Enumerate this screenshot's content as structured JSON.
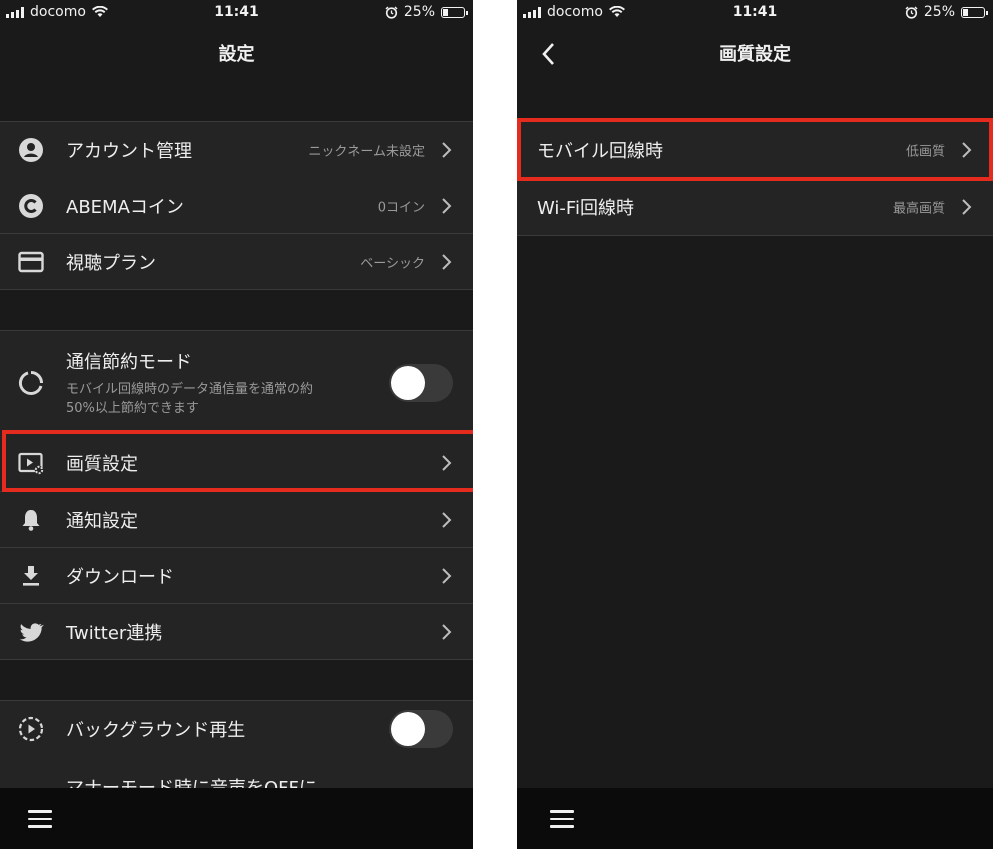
{
  "status_bar": {
    "carrier": "docomo",
    "time": "11:41",
    "battery": "25%"
  },
  "left": {
    "title": "設定",
    "rows": [
      {
        "icon": "account-circle-icon",
        "label": "アカウント管理",
        "value": "ニックネーム未設定"
      },
      {
        "icon": "coin-icon",
        "label": "ABEMAコイン",
        "value": "0コイン"
      },
      {
        "icon": "credit-card-icon",
        "label": "視聴プラン",
        "value": "ベーシック"
      }
    ],
    "data_saver": {
      "icon": "data-saver-icon",
      "label": "通信節約モード",
      "description_line1": "モバイル回線時のデータ通信量を通常の約",
      "description_line2": "50%以上節約できます",
      "enabled": false
    },
    "rows2": [
      {
        "icon": "video-settings-icon",
        "label": "画質設定"
      },
      {
        "icon": "bell-icon",
        "label": "通知設定"
      },
      {
        "icon": "download-icon",
        "label": "ダウンロード"
      },
      {
        "icon": "twitter-icon",
        "label": "Twitter連携"
      }
    ],
    "background_play": {
      "icon": "background-play-icon",
      "label": "バックグラウンド再生",
      "enabled": false
    },
    "cut_off_text": "マナーモード時に音声をOFFに"
  },
  "right": {
    "title": "画質設定",
    "rows": [
      {
        "label": "モバイル回線時",
        "value": "低画質"
      },
      {
        "label": "Wi-Fi回線時",
        "value": "最高画質"
      }
    ]
  },
  "colors": {
    "background": "#1a1a1a",
    "row": "#242424",
    "highlight": "#e52a1e",
    "bottom_bar": "#0b0b0b"
  }
}
